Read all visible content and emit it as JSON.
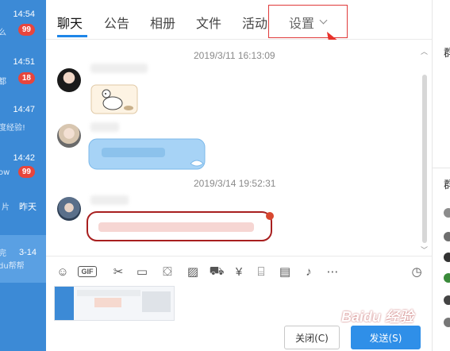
{
  "conversations": [
    {
      "time": "14:54",
      "snippet": "么",
      "badge": "99"
    },
    {
      "time": "14:51",
      "snippet": "都",
      "badge": "18"
    },
    {
      "time": "14:47",
      "snippet": "度经验!",
      "badge": ""
    },
    {
      "time": "14:42",
      "snippet": "ow",
      "badge": "99"
    },
    {
      "time": "昨天",
      "snippet": "片",
      "badge": ""
    },
    {
      "time": "3-14",
      "snippet": "完\ndu帮帮",
      "badge": ""
    }
  ],
  "tabs": [
    "聊天",
    "公告",
    "相册",
    "文件",
    "活动",
    "设置"
  ],
  "timestamps": [
    "2019/3/11 16:13:09",
    "2019/3/14 19:52:31"
  ],
  "toolbar_icons": [
    "emoji-icon",
    "gif-icon",
    "scissors-icon",
    "folder-icon",
    "gift-box-icon",
    "image-icon",
    "car-icon",
    "red-packet-icon",
    "present-icon",
    "calendar-icon",
    "bell-icon",
    "more-icon",
    "history-clock-icon"
  ],
  "buttons": {
    "close": "关闭(C)",
    "send": "发送(S)"
  },
  "right_panel": {
    "title1": "群",
    "title2": "群"
  },
  "watermark": "Baidu 经验",
  "colors": {
    "accent": "#1f86e8",
    "sidebar": "#3c8ad6",
    "badge": "#e8453c",
    "highlight": "#e03a3a"
  }
}
